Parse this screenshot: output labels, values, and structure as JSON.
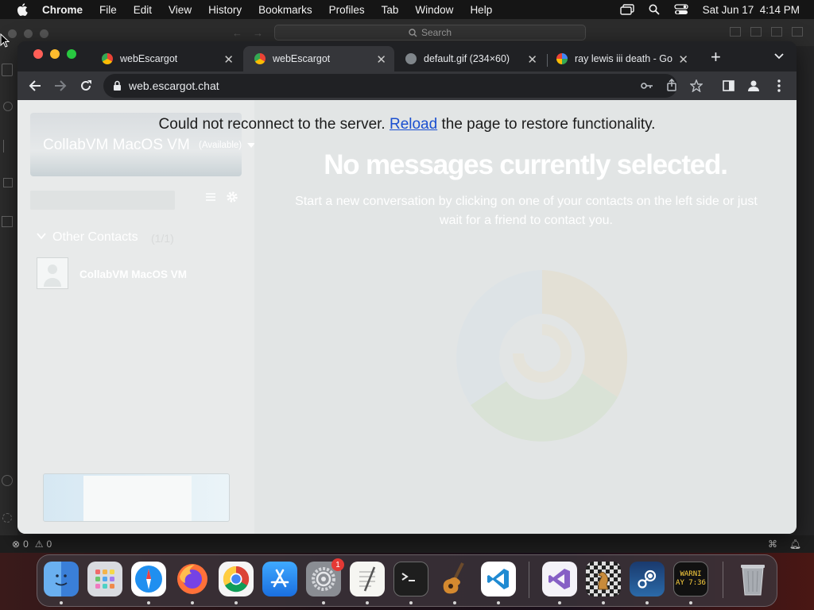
{
  "menubar": {
    "app_name": "Chrome",
    "items": [
      "File",
      "Edit",
      "View",
      "History",
      "Bookmarks",
      "Profiles",
      "Tab",
      "Window",
      "Help"
    ],
    "datetime": "Sat Jun 17  4:14 PM"
  },
  "background_window": {
    "search_placeholder": "Search",
    "status_errors": "0",
    "status_warnings": "0"
  },
  "chrome": {
    "tabs": [
      {
        "title": "webEscargot",
        "active": false
      },
      {
        "title": "webEscargot",
        "active": true
      },
      {
        "title": "default.gif (234×60)",
        "active": false
      },
      {
        "title": "ray lewis iii death - Go",
        "active": false
      }
    ],
    "new_tab_label": "+",
    "url": "web.escargot.chat"
  },
  "page": {
    "banner_before": "Could not reconnect to the server. ",
    "banner_link": "Reload",
    "banner_after": " the page to restore functionality.",
    "headline": "No messages currently selected.",
    "subtext": "Start a new conversation by clicking on one of your contacts on the left side or just wait for a friend to contact you.",
    "sidebar": {
      "profile_name": "CollabVM MacOS VM",
      "profile_status": "(Available)",
      "group_label": "Other Contacts",
      "group_count": "(1/1)",
      "contacts": [
        {
          "name": "CollabVM MacOS VM"
        }
      ]
    }
  },
  "dock": {
    "apps": [
      "finder-icon",
      "launchpad-icon",
      "safari-icon",
      "firefox-icon",
      "chrome-icon",
      "app-store-icon",
      "system-settings-icon",
      "textedit-icon",
      "terminal-icon",
      "garageband-icon",
      "vscode-icon",
      "visual-studio-icon",
      "chess-icon",
      "steam-icon",
      "console-icon",
      "trash-icon"
    ],
    "settings_badge": "1",
    "console_text": "WARNI\nAY 7:36"
  }
}
